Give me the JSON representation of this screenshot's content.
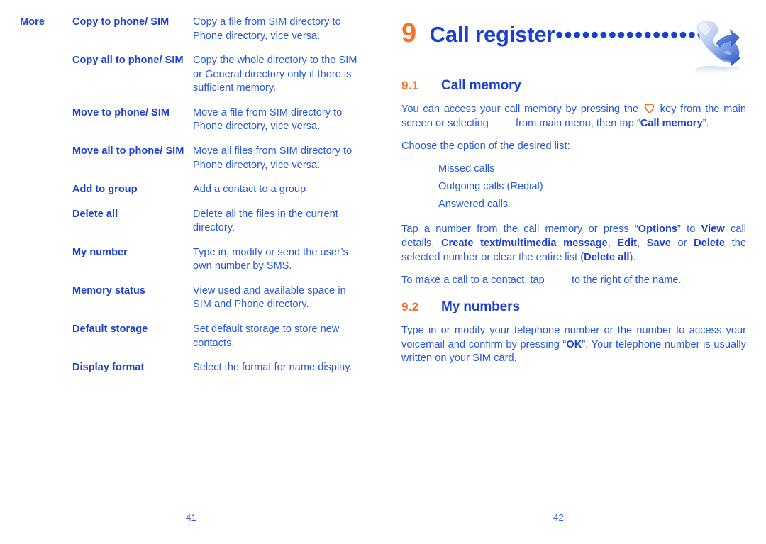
{
  "document": {
    "accent_blue_heading": "#1c3fd2",
    "accent_blue_body": "#2457dd",
    "accent_orange": "#f4732a"
  },
  "left_page": {
    "group_label": "More",
    "folio": "41",
    "options": [
      {
        "name": "Copy to phone/ SIM",
        "description": "Copy a file from SIM directory to Phone directory, vice versa."
      },
      {
        "name": "Copy all to phone/ SIM",
        "description": "Copy the whole directory to the SIM or General directory only if there is sufficient memory."
      },
      {
        "name": "Move to phone/ SIM",
        "description": "Move a file from SIM directory to Phone directory, vice versa."
      },
      {
        "name": "Move all to phone/ SIM",
        "description": "Move all files from SIM directory to Phone directory, vice versa."
      },
      {
        "name": "Add to group",
        "description": "Add a contact to a group"
      },
      {
        "name": "Delete all",
        "description": "Delete all the files in the current directory."
      },
      {
        "name": "My number",
        "description": "Type in, modify or send the user’s own number by SMS."
      },
      {
        "name": "Memory status",
        "description": "View used and available space in SIM and Phone directory."
      },
      {
        "name": "Default storage",
        "description": "Set default storage to store new contacts."
      },
      {
        "name": "Display format",
        "description": "Select the format for name display."
      }
    ]
  },
  "right_page": {
    "folio": "42",
    "chapter": {
      "number": "9",
      "title": "Call register",
      "leader": "•••••••••••••••••",
      "icon_name": "phone-call-register-icon"
    },
    "sections": [
      {
        "number": "9.1",
        "title": "Call memory",
        "paragraph_1_part_1": "You can access your call memory by pressing the",
        "paragraph_1_part_2": "key from the main screen or selecting",
        "paragraph_1_part_3": "from main menu, then tap “",
        "paragraph_1_bold": "Call memory",
        "paragraph_1_part_4": "”.",
        "choose_intro": "Choose the option of the desired list:",
        "list": [
          "Missed calls",
          "Outgoing calls (Redial)",
          "Answered calls"
        ],
        "paragraph_2": {
          "t1": "Tap a number from the call memory or press “",
          "b1": "Options",
          "t2": "” to ",
          "b2": "View",
          "t3": " call details, ",
          "b3": "Create text/multimedia message",
          "t4": ", ",
          "b4": "Edit",
          "t5": ", ",
          "b5": "Save",
          "t6": " or ",
          "b6": "Delete",
          "t7": " the selected number or clear the entire list (",
          "b7": "Delete all",
          "t8": ")."
        },
        "paragraph_3_part_1": "To make a call to a contact, tap",
        "paragraph_3_part_2": "to the right of the name."
      },
      {
        "number": "9.2",
        "title": "My numbers",
        "paragraph": {
          "t1": "Type in or modify your telephone number or the number to access your voicemail and confirm by pressing “",
          "b1": "OK",
          "t2": "”. Your telephone number is usually written on your SIM card."
        }
      }
    ]
  }
}
